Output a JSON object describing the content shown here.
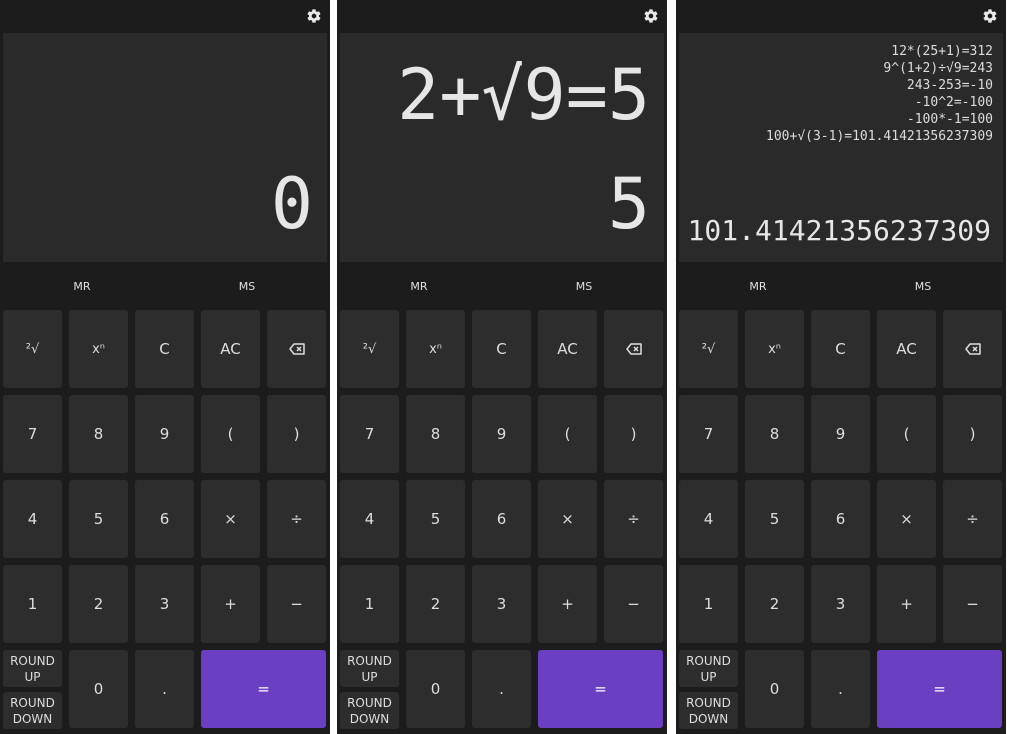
{
  "colors": {
    "background": "#1c1c1c",
    "display": "#2a2a2a",
    "key": "#2d2d2d",
    "accent": "#6a3fc2"
  },
  "memory": {
    "recall_label": "MR",
    "store_label": "MS"
  },
  "keys": {
    "root": "²√",
    "power": "xⁿ",
    "clear": "C",
    "all_clear": "AC",
    "backspace": "backspace-icon",
    "seven": "7",
    "eight": "8",
    "nine": "9",
    "open_paren": "(",
    "close_paren": ")",
    "four": "4",
    "five": "5",
    "six": "6",
    "multiply": "×",
    "divide": "÷",
    "one": "1",
    "two": "2",
    "three": "3",
    "plus": "+",
    "minus": "−",
    "round_up": "ROUND\nUP",
    "round_down": "ROUND\nDOWN",
    "zero": "0",
    "decimal": ".",
    "equals": "="
  },
  "screens": [
    {
      "expression": "",
      "result": "0",
      "history": []
    },
    {
      "expression": "2+√9=5",
      "result": "5",
      "history": []
    },
    {
      "expression": "",
      "result": "101.41421356237309",
      "history": [
        "12*(25+1)=312",
        "9^(1+2)÷√9=243",
        "243-253=-10",
        "-10^2=-100",
        "-100*-1=100",
        "100+√(3-1)=101.41421356237309"
      ]
    }
  ]
}
